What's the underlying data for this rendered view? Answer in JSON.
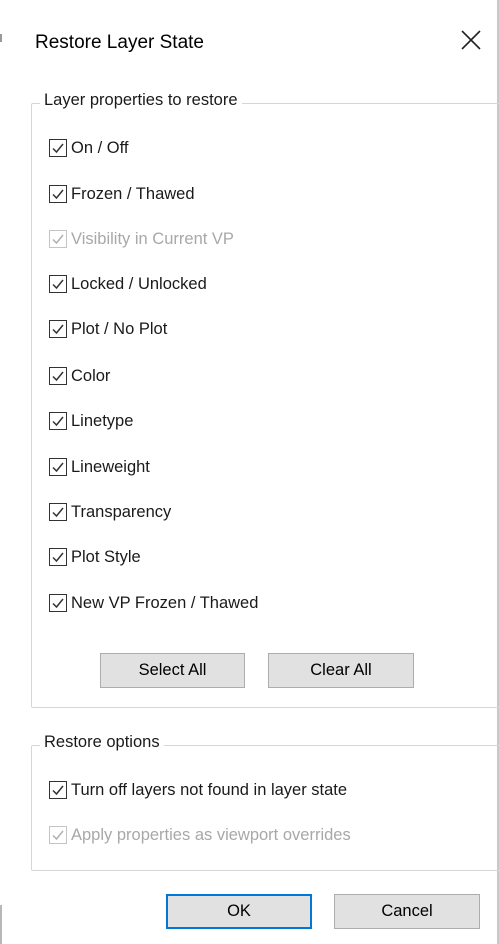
{
  "dialog": {
    "title": "Restore Layer State",
    "close_glyph": "✕"
  },
  "layer_properties": {
    "legend": "Layer properties to restore",
    "items": [
      {
        "label": "On / Off",
        "checked": true,
        "enabled": true
      },
      {
        "label": "Frozen / Thawed",
        "checked": true,
        "enabled": true
      },
      {
        "label": "Visibility in Current VP",
        "checked": true,
        "enabled": false
      },
      {
        "label": "Locked / Unlocked",
        "checked": true,
        "enabled": true
      },
      {
        "label": "Plot / No Plot",
        "checked": true,
        "enabled": true
      },
      {
        "label": "Color",
        "checked": true,
        "enabled": true
      },
      {
        "label": "Linetype",
        "checked": true,
        "enabled": true
      },
      {
        "label": "Lineweight",
        "checked": true,
        "enabled": true
      },
      {
        "label": "Transparency",
        "checked": true,
        "enabled": true
      },
      {
        "label": "Plot Style",
        "checked": true,
        "enabled": true
      },
      {
        "label": "New VP Frozen / Thawed",
        "checked": true,
        "enabled": true
      }
    ],
    "select_all_label": "Select All",
    "clear_all_label": "Clear All"
  },
  "restore_options": {
    "legend": "Restore options",
    "items": [
      {
        "label": "Turn off layers not found in layer state",
        "checked": true,
        "enabled": true
      },
      {
        "label": "Apply properties as viewport overrides",
        "checked": true,
        "enabled": false
      }
    ]
  },
  "footer": {
    "ok_label": "OK",
    "cancel_label": "Cancel"
  },
  "colors": {
    "default_button_border": "#0078d7",
    "disabled_text": "#a8a8a8",
    "button_face": "#e1e1e1"
  }
}
